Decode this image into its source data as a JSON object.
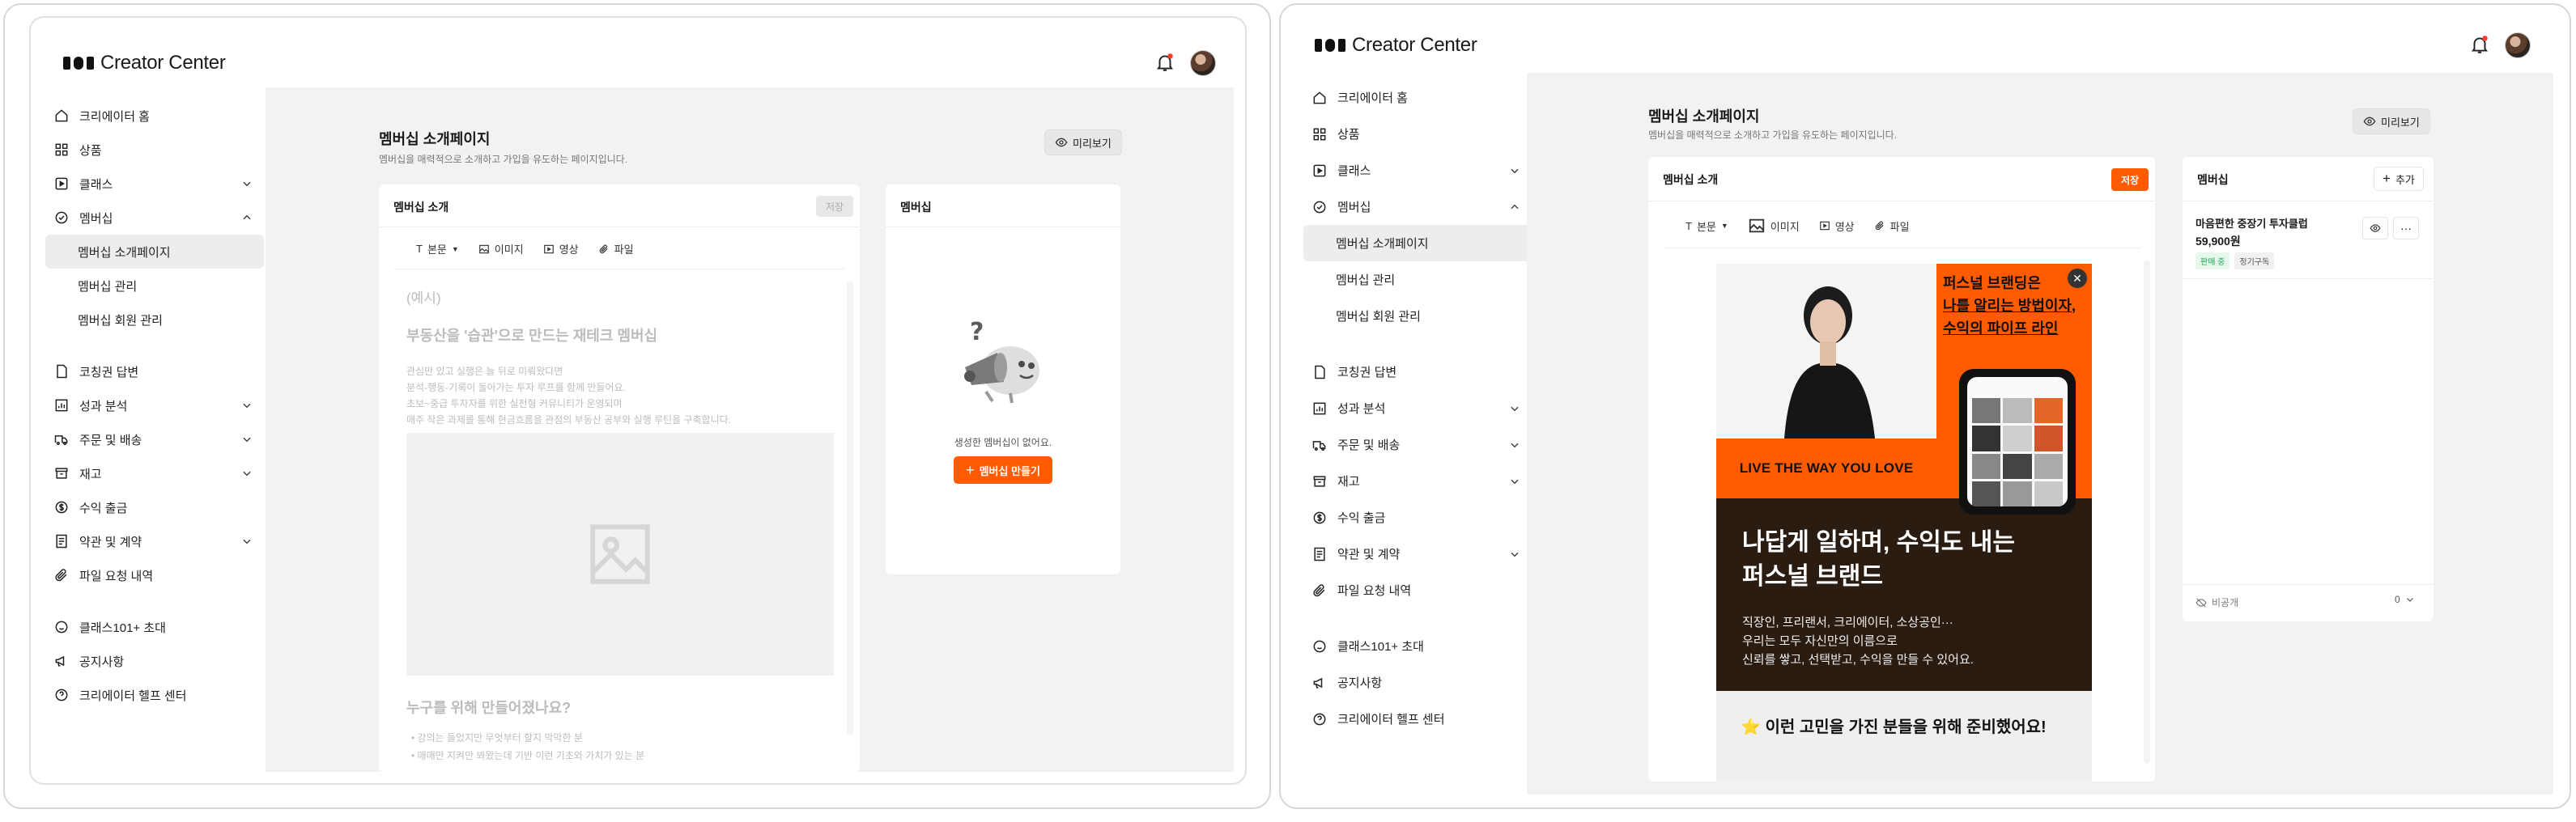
{
  "brand": {
    "name": "Creator Center"
  },
  "colors": {
    "accent": "#ff5b00",
    "dark_panel": "#2b1c12",
    "sidebar_active": "#ededed",
    "main_bg": "#f2f2f2"
  },
  "sidebar": {
    "items": [
      {
        "label": "크리에이터 홈",
        "icon": "home-icon"
      },
      {
        "label": "상품",
        "icon": "grid-icon"
      },
      {
        "label": "클래스",
        "icon": "play-square-icon"
      },
      {
        "label": "멤버십",
        "icon": "check-circle-icon"
      },
      {
        "label": "코칭권 답변",
        "icon": "document-icon"
      },
      {
        "label": "성과 분석",
        "icon": "bar-chart-icon"
      },
      {
        "label": "주문 및 배송",
        "icon": "truck-icon"
      },
      {
        "label": "재고",
        "icon": "box-icon"
      },
      {
        "label": "수익 출금",
        "icon": "dollar-circle-icon"
      },
      {
        "label": "약관 및 계약",
        "icon": "contract-icon"
      },
      {
        "label": "파일 요청 내역",
        "icon": "paperclip-icon"
      },
      {
        "label": "클래스101+ 초대",
        "icon": "smile-icon"
      },
      {
        "label": "공지사항",
        "icon": "megaphone-icon"
      },
      {
        "label": "크리에이터 헬프 센터",
        "icon": "help-circle-icon"
      }
    ],
    "membership_sub": [
      "멤버십 소개페이지",
      "멤버십 관리",
      "멤버십 회원 관리"
    ]
  },
  "page": {
    "title": "멤버십 소개페이지",
    "subtitle": "멤버십을 매력적으로 소개하고 가입을 유도하는 페이지입니다.",
    "preview_label": "미리보기"
  },
  "left": {
    "editor_title": "멤버십 소개",
    "save_label": "저장",
    "toolbar": {
      "body": "본문",
      "image": "이미지",
      "video": "영상",
      "file": "파일"
    },
    "draft": {
      "example": "(예시)",
      "heading": "부동산을 '습관'으로 만드는 재테크 멤버십",
      "p1": "관심만 있고 실행은 늘 뒤로 미뤄왔다면",
      "p2": "분석-행동-기록이 돌아가는 투자 루프를 함께 만들어요.",
      "p3": "초보~중급 투자자를 위한 실전형 커뮤니티가 운영되며",
      "p4": "매주 작은 과제를 통해 현금흐름을 관점의 부동산 공부와 실행 루틴을 구축합니다.",
      "h2": "누구를 위해 만들어졌나요?",
      "b1": "• 강의는 들었지만 무엇부터 할지 막막한 분",
      "b2": "• 매매만 지켜만 봐왔는데 기반 이런 기초와 가치가 있는 분"
    },
    "membership_title": "멤버십",
    "empty_text": "생성한 멤버십이 없어요.",
    "create_label": "멤버십 만들기"
  },
  "right": {
    "editor_title": "멤버십 소개",
    "save_label": "저장",
    "toolbar": {
      "body": "본문",
      "image": "이미지",
      "video": "영상",
      "file": "파일"
    },
    "banner": {
      "headline_1": "퍼스널 브랜딩은",
      "headline_2": "나를 알리는 방법이자,",
      "headline_3": "수익의 파이프 라인",
      "live": "LIVE THE WAY YOU LOVE",
      "title_1": "나답게 일하며, 수익도 내는",
      "title_2": "퍼스널 브랜드",
      "desc_1": "직장인, 프리랜서, 크리에이터, 소상공인···",
      "desc_2": "우리는 모두 자신만의 이름으로",
      "desc_3": "신뢰를 쌓고, 선택받고, 수익을 만들 수 있어요.",
      "bottom": "⭐ 이런 고민을 가진 분들을 위해 준비했어요!"
    },
    "membership_title": "멤버십",
    "add_label": "추가",
    "product": {
      "name": "마음편한 중장기 투자클럽",
      "price": "59,900원",
      "tag_sale": "판매 중",
      "tag_type": "정기구독"
    },
    "visibility": "비공개",
    "count": "0"
  }
}
